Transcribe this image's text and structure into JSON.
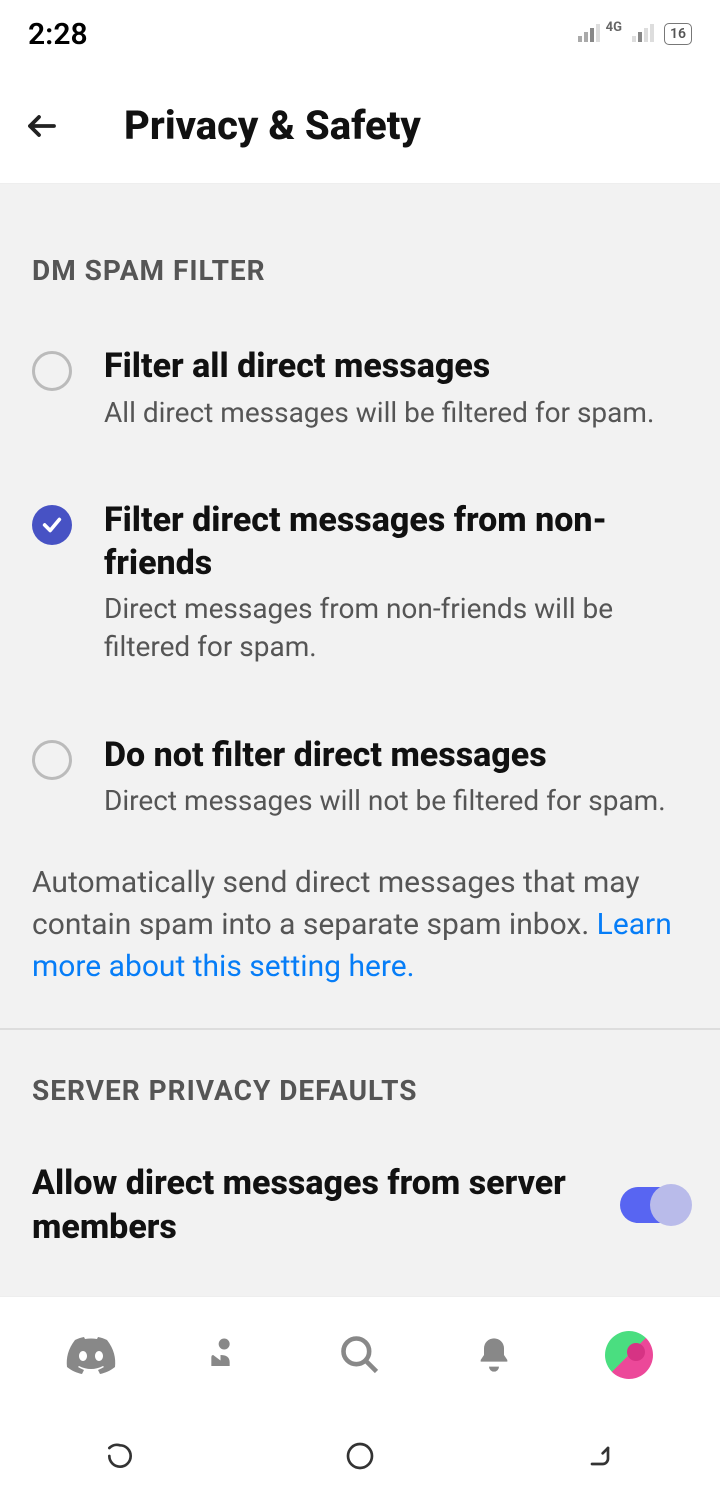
{
  "status": {
    "time": "2:28",
    "network": "4G",
    "battery": "16"
  },
  "header": {
    "title": "Privacy & Safety"
  },
  "dm_filter": {
    "section_label": "DM SPAM FILTER",
    "options": [
      {
        "title": "Filter all direct messages",
        "desc": "All direct messages will be filtered for spam.",
        "selected": false
      },
      {
        "title": "Filter direct messages from non-friends",
        "desc": "Direct messages from non-friends will be filtered for spam.",
        "selected": true
      },
      {
        "title": "Do not filter direct messages",
        "desc": "Direct messages will not be filtered for spam.",
        "selected": false
      }
    ],
    "footer_text": "Automatically send direct messages that may contain spam into a separate spam inbox. ",
    "footer_link": "Learn more about this setting here."
  },
  "server_privacy": {
    "section_label": "SERVER PRIVACY DEFAULTS",
    "allow_dm": {
      "label": "Allow direct messages from server members",
      "enabled": true
    }
  }
}
